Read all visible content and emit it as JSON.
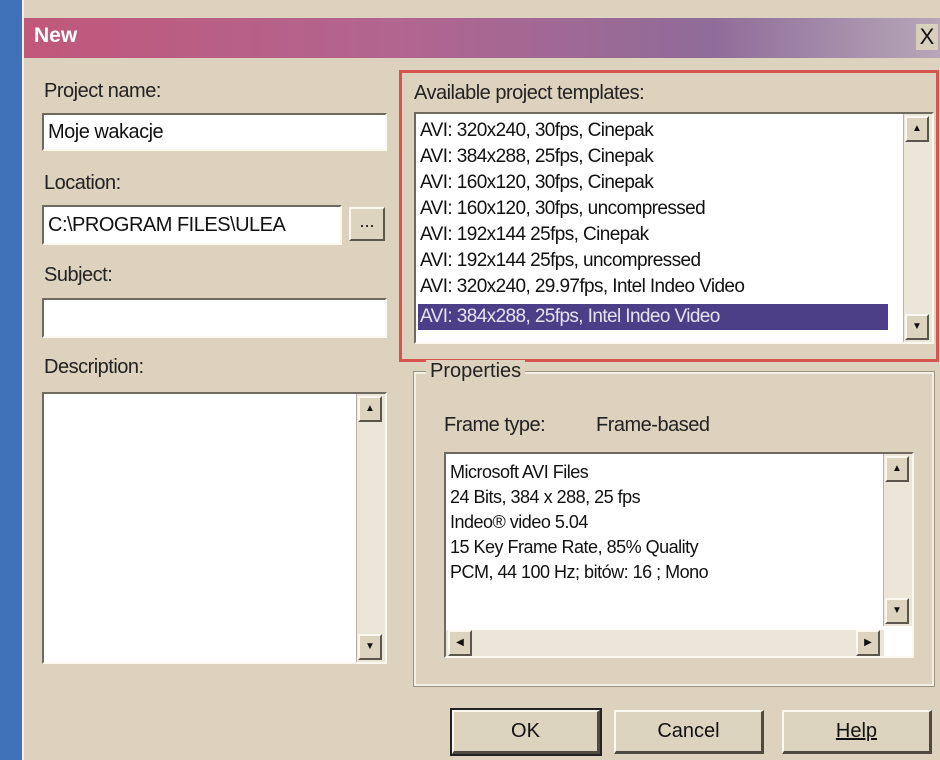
{
  "window": {
    "title": "New",
    "close_glyph": "X"
  },
  "left": {
    "project_name_label": "Project name:",
    "project_name_value": "Moje wakacje",
    "location_label": "Location:",
    "location_value": "C:\\PROGRAM FILES\\ULEA",
    "browse_label": "...",
    "subject_label": "Subject:",
    "subject_value": "",
    "description_label": "Description:",
    "description_value": ""
  },
  "templates": {
    "label": "Available project templates:",
    "items": [
      "AVI: 320x240, 30fps, Cinepak",
      "AVI: 384x288, 25fps, Cinepak",
      "AVI: 160x120, 30fps, Cinepak",
      "AVI: 160x120, 30fps, uncompressed",
      "AVI: 192x144 25fps, Cinepak",
      "AVI: 192x144 25fps, uncompressed",
      "AVI: 320x240, 29.97fps, Intel Indeo Video",
      "AVI: 384x288, 25fps, Intel Indeo Video"
    ],
    "selected_index": 7
  },
  "properties": {
    "group_label": "Properties",
    "frame_type_label": "Frame type:",
    "frame_type_value": "Frame-based",
    "details": [
      "Microsoft AVI Files",
      "24 Bits, 384 x 288, 25 fps",
      "Indeo® video 5.04",
      "15 Key Frame Rate, 85% Quality",
      "PCM, 44 100 Hz; bitów: 16 ; Mono"
    ]
  },
  "buttons": {
    "ok": "OK",
    "cancel": "Cancel",
    "help": "Help"
  },
  "icons": {
    "scroll_up": "up-arrow-icon",
    "scroll_down": "down-arrow-icon",
    "scroll_left": "left-arrow-icon",
    "scroll_right": "right-arrow-icon"
  },
  "colors": {
    "highlight_border": "#d9544f",
    "selection": "#4c3f88"
  }
}
